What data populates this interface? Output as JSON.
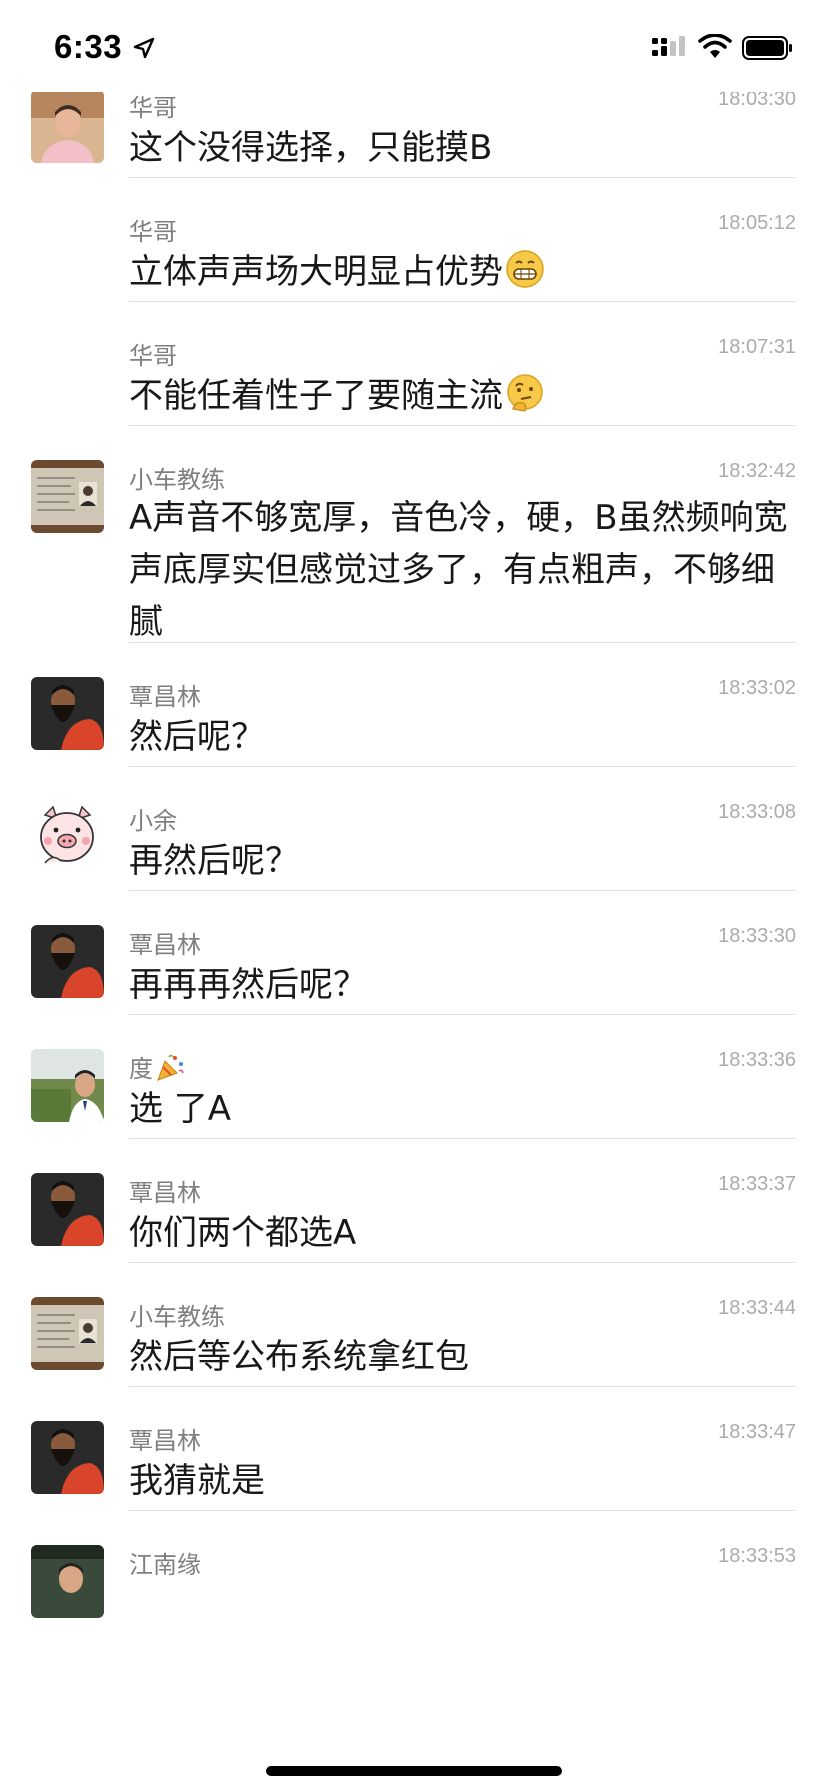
{
  "status_bar": {
    "time": "6:33"
  },
  "messages": [
    {
      "sender": "华哥",
      "time": "18:03:30",
      "text": "这个没得选择，只能摸B"
    },
    {
      "sender": "华哥",
      "time": "18:05:12",
      "text": "立体声声场大明显占优势"
    },
    {
      "sender": "华哥",
      "time": "18:07:31",
      "text": "不能任着性子了要随主流"
    },
    {
      "sender": "小车教练",
      "time": "18:32:42",
      "text": "A声音不够宽厚，音色冷，硬，B虽然频响宽声底厚实但感觉过多了，有点粗声，不够细腻"
    },
    {
      "sender": "覃昌林",
      "time": "18:33:02",
      "text": "然后呢？"
    },
    {
      "sender": "小余",
      "time": "18:33:08",
      "text": "再然后呢？"
    },
    {
      "sender": "覃昌林",
      "time": "18:33:30",
      "text": "再再再然后呢？"
    },
    {
      "sender": "度",
      "time": "18:33:36",
      "text": "选 了A"
    },
    {
      "sender": "覃昌林",
      "time": "18:33:37",
      "text": "你们两个都选A"
    },
    {
      "sender": "小车教练",
      "time": "18:33:44",
      "text": "然后等公布系统拿红包"
    },
    {
      "sender": "覃昌林",
      "time": "18:33:47",
      "text": "我猜就是"
    },
    {
      "sender": "江南缘",
      "time": "18:33:53",
      "text": ""
    }
  ]
}
